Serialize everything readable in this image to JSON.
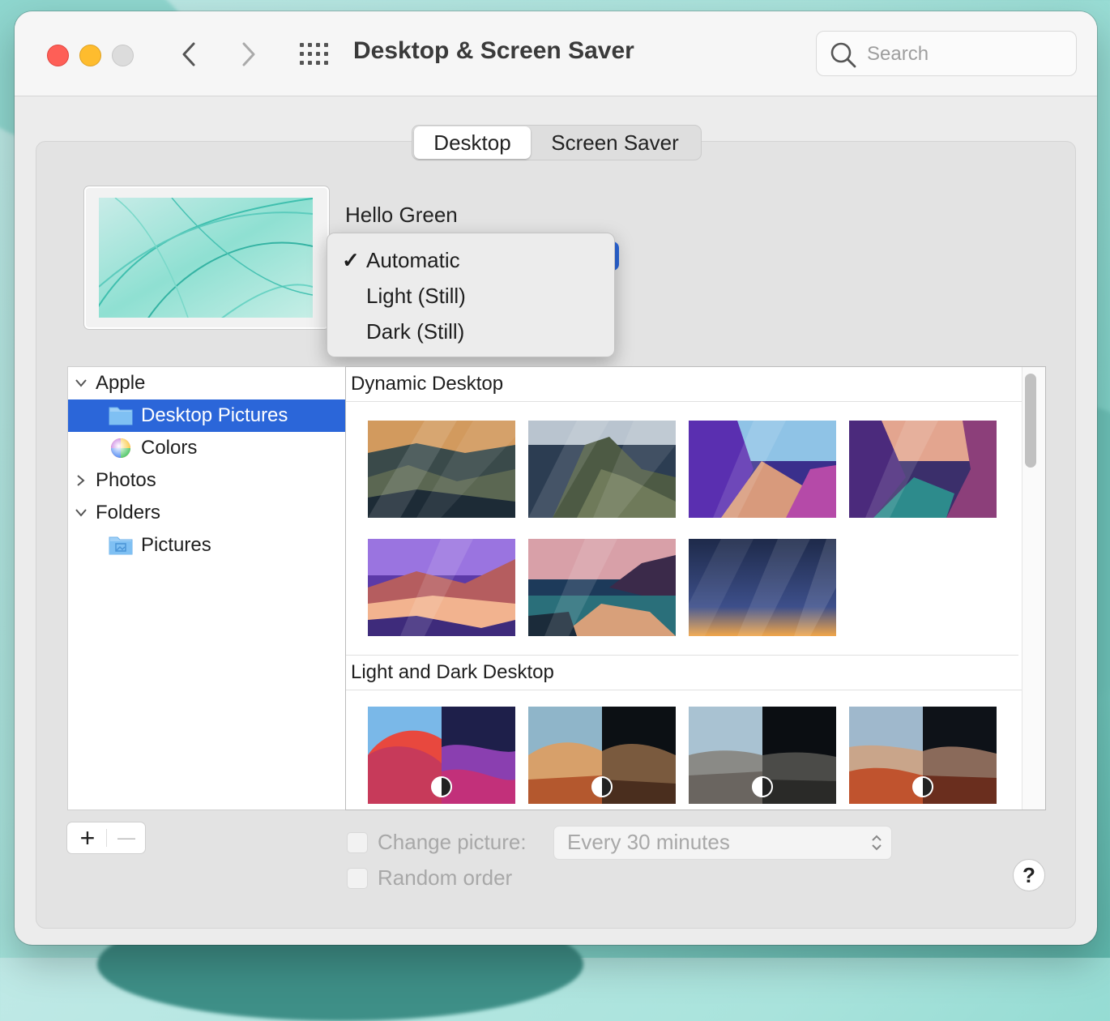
{
  "window": {
    "title": "Desktop & Screen Saver"
  },
  "search": {
    "placeholder": "Search"
  },
  "tabs": [
    {
      "label": "Desktop"
    },
    {
      "label": "Screen Saver"
    }
  ],
  "current_wallpaper": {
    "name": "Hello Green"
  },
  "appearance_menu": {
    "items": [
      {
        "label": "Automatic",
        "checked": true
      },
      {
        "label": "Light (Still)",
        "checked": false
      },
      {
        "label": "Dark (Still)",
        "checked": false
      }
    ],
    "check_glyph": "✓"
  },
  "sidebar": {
    "items": [
      {
        "label": "Apple"
      },
      {
        "label": "Desktop Pictures"
      },
      {
        "label": "Colors"
      },
      {
        "label": "Photos"
      },
      {
        "label": "Folders"
      },
      {
        "label": "Pictures"
      }
    ]
  },
  "gallery": {
    "sections": [
      {
        "title": "Dynamic Desktop"
      },
      {
        "title": "Light and Dark Desktop"
      }
    ]
  },
  "bottom": {
    "add_label": "+",
    "remove_label": "—",
    "change_picture_label": "Change picture:",
    "interval_value": "Every 30 minutes",
    "random_order_label": "Random order",
    "help_label": "?"
  },
  "colors": {
    "accent": "#2b66d9",
    "close": "#fe5f57",
    "minimize": "#febc2e"
  }
}
